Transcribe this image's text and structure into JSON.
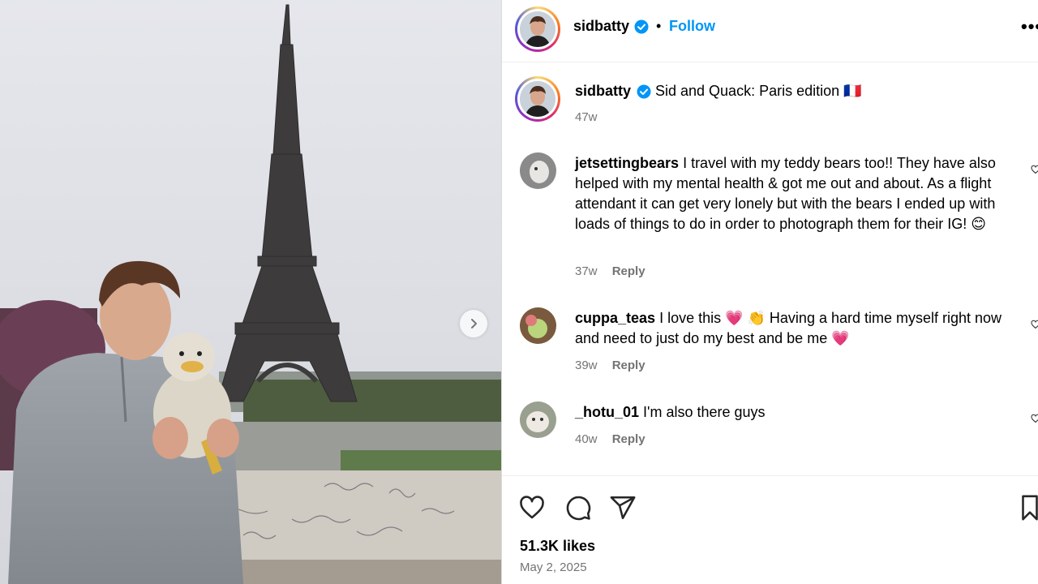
{
  "post": {
    "username": "sidbatty",
    "follow_label": "Follow",
    "separator": "•",
    "more_label": "•••"
  },
  "caption": {
    "username": "sidbatty",
    "text": "Sid and Quack: Paris edition 🇫🇷",
    "time": "47w"
  },
  "comments": [
    {
      "username": "jetsettingbears",
      "text": "I travel with my teddy bears too!! They have also helped with my mental health & got me out and about. As a flight attendant it can get very lonely but with the bears I ended up with loads of things to do in order to photograph them for their IG! 😊",
      "time": "37w",
      "reply": "Reply"
    },
    {
      "username": "cuppa_teas",
      "text": "I love this 💗 👏 Having a hard time myself right now and need to just do my best and be me 💗",
      "time": "39w",
      "reply": "Reply"
    },
    {
      "username": "_hotu_01",
      "text": "I'm also there guys",
      "time": "40w",
      "reply": "Reply"
    }
  ],
  "footer": {
    "likes": "51.3K likes",
    "date": "May 2, 2025"
  },
  "colors": {
    "link_blue": "#0095f6",
    "verified_blue": "#0095f6",
    "muted": "#737373"
  },
  "icons": {
    "like": "heart-icon",
    "comment": "comment-icon",
    "share": "share-icon",
    "save": "bookmark-icon",
    "verified": "verified-badge-icon",
    "next": "chevron-right-icon"
  }
}
